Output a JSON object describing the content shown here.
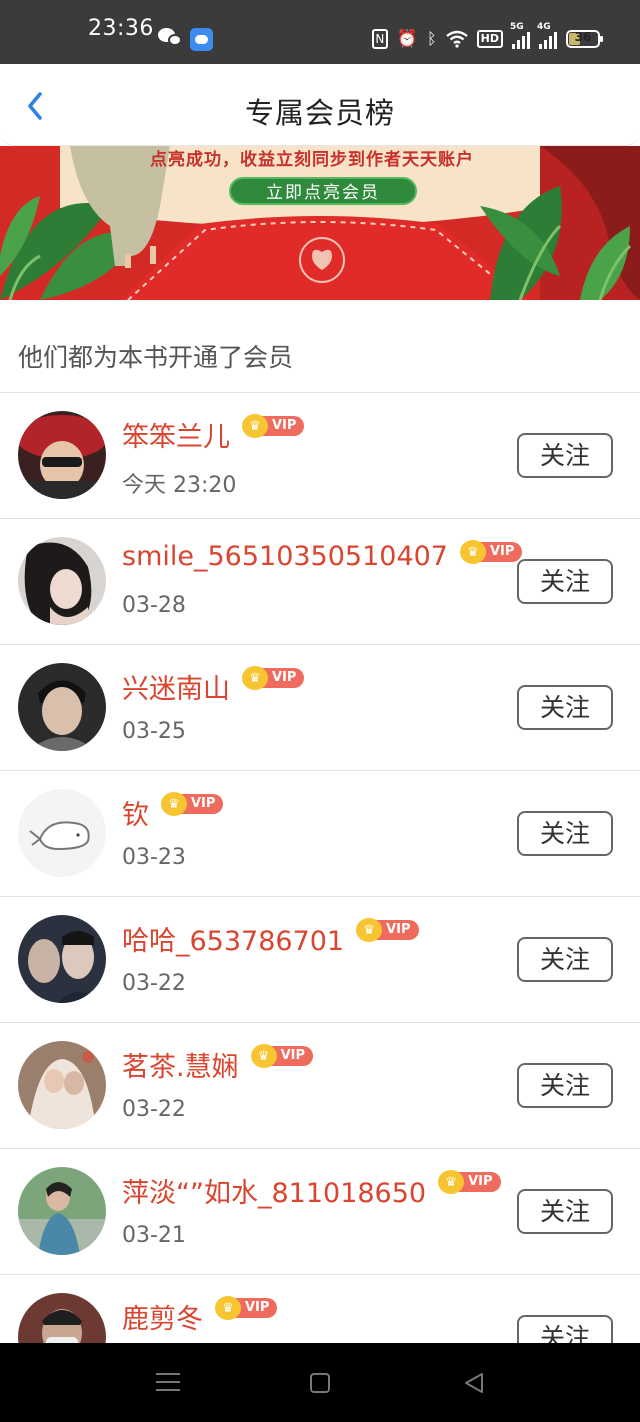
{
  "status_bar": {
    "time": "23:36",
    "network_label": "4G",
    "network_label_2": "5G",
    "hd_label": "HD",
    "battery": "36"
  },
  "header": {
    "title": "专属会员榜"
  },
  "banner": {
    "top_text": "点亮成功，收益立刻同步到作者天天账户",
    "button_label": "立即点亮会员"
  },
  "section": {
    "title": "他们都为本书开通了会员"
  },
  "vip_label": "VIP",
  "follow_label": "关注",
  "members": [
    {
      "name": "笨笨兰儿",
      "date": "今天 23:20",
      "avatar": "red-hat-person"
    },
    {
      "name": "smile_56510350510407",
      "date": "03-28",
      "avatar": "woman-dark-hair"
    },
    {
      "name": "兴迷南山",
      "date": "03-25",
      "avatar": "young-man"
    },
    {
      "name": "钦",
      "date": "03-23",
      "avatar": "whale-drawing"
    },
    {
      "name": "哈哈_653786701",
      "date": "03-22",
      "avatar": "two-men"
    },
    {
      "name": "茗茶.慧娴",
      "date": "03-22",
      "avatar": "couple-veil"
    },
    {
      "name": "萍淡“”如水_811018650",
      "date": "03-21",
      "avatar": "woman-outdoors"
    },
    {
      "name": "鹿剪冬",
      "date": "",
      "avatar": "man-masked"
    }
  ]
}
